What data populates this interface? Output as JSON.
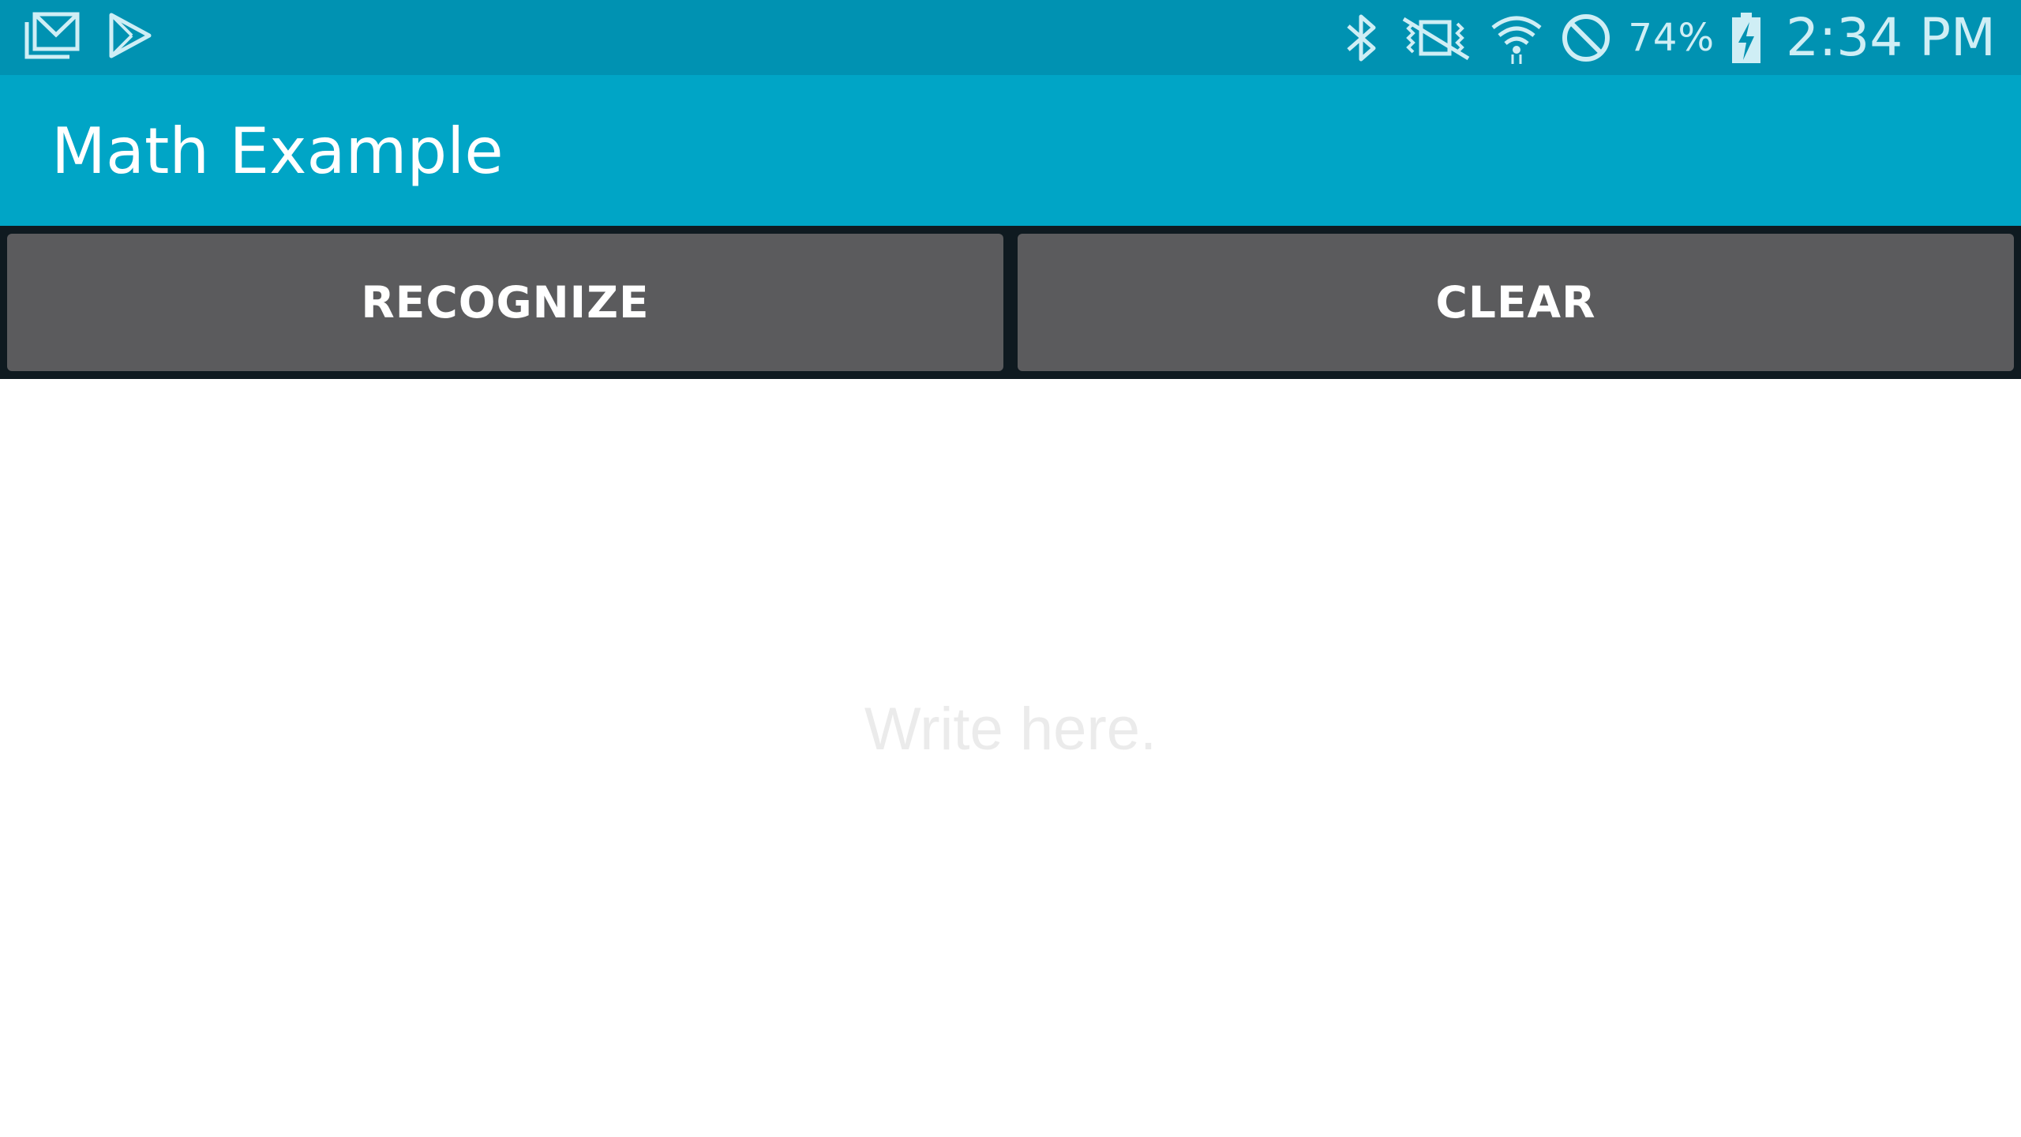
{
  "status_bar": {
    "left_icons": [
      "gmail-icon",
      "play-store-icon"
    ],
    "right_icons": [
      "bluetooth-icon",
      "vibrate-icon",
      "wifi-icon",
      "do-not-disturb-icon",
      "battery-charging-icon"
    ],
    "battery_percent": "74%",
    "time": "2:34 PM"
  },
  "app_bar": {
    "title": "Math Example"
  },
  "buttons": {
    "recognize_label": "RECOGNIZE",
    "clear_label": "CLEAR"
  },
  "canvas": {
    "placeholder": "Write here."
  },
  "colors": {
    "status_bar": "#0092b2",
    "app_bar": "#00a5c6",
    "button_bg": "#5b5b5d",
    "button_strip": "#0f1a20",
    "canvas_bg": "#ffffff",
    "placeholder_text": "#ebebeb"
  }
}
